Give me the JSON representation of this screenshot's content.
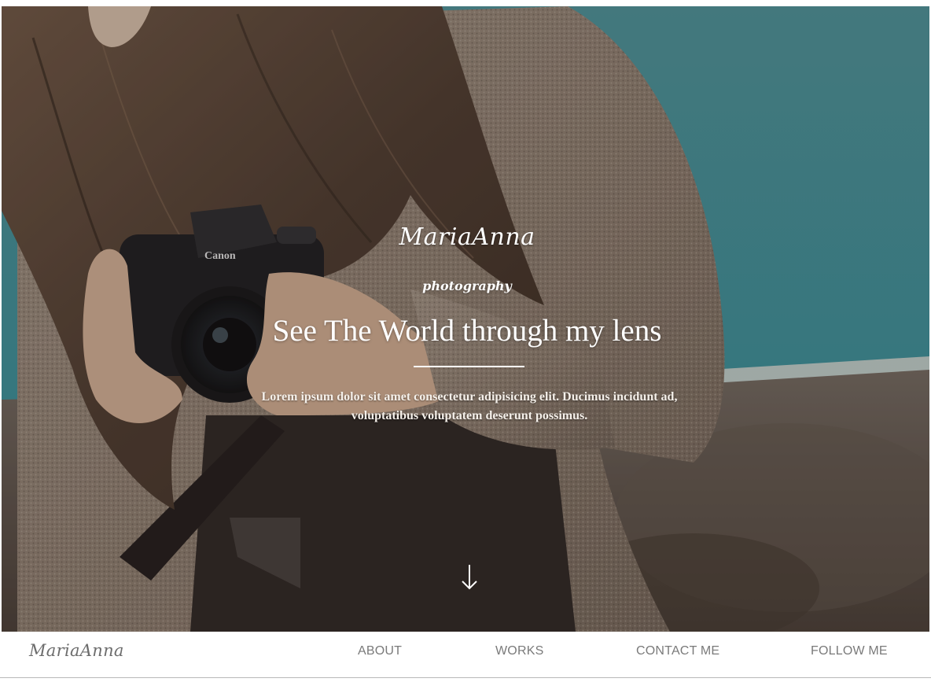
{
  "hero": {
    "brand": "MariaAnna",
    "subtitle": "photography",
    "headline": "See The World through my lens",
    "lede": "Lorem ipsum dolor sit amet consectetur adipisicing elit. Ducimus incidunt ad, voluptatibus voluptatem deserunt possimus.",
    "scroll_icon": "arrow-down-icon",
    "photo_label": "Canon"
  },
  "navbar": {
    "logo": "MariaAnna",
    "links": [
      {
        "label": "ABOUT"
      },
      {
        "label": "WORKS"
      },
      {
        "label": "CONTACT ME"
      },
      {
        "label": "FOLLOW ME"
      }
    ]
  },
  "colors": {
    "sky": "#3d8f97",
    "sweater": "#8a7d70",
    "nav_text": "#7a7a7a",
    "hero_text": "#ffffff"
  }
}
